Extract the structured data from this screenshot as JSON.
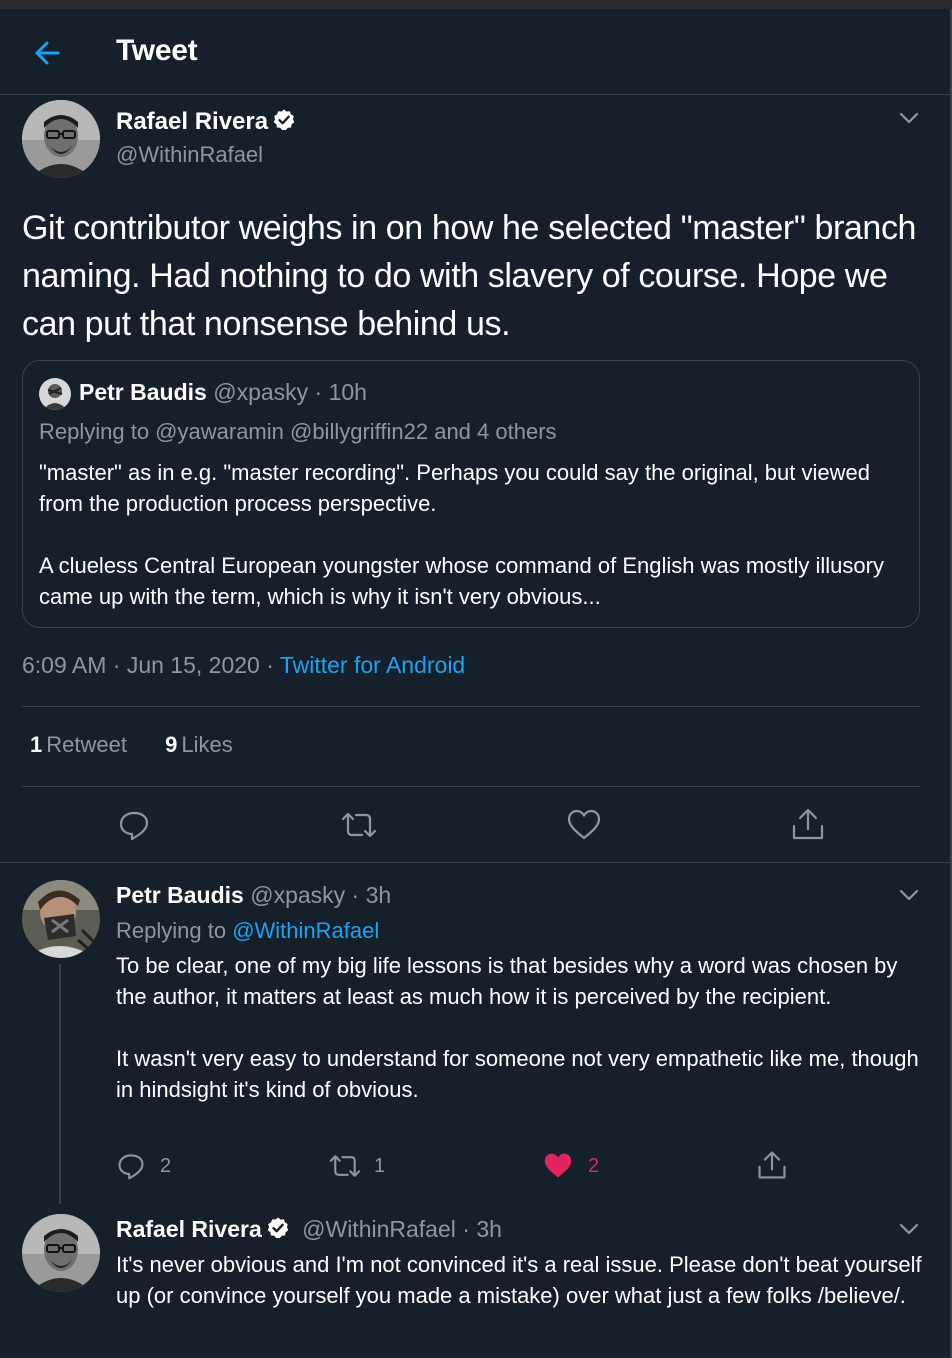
{
  "header": {
    "title": "Tweet"
  },
  "tweet": {
    "author_name": "Rafael Rivera",
    "author_handle": "@WithinRafael",
    "text": "Git contributor weighs in on how he selected \"master\" branch naming. Had nothing to do with slavery of course. Hope we can put that nonsense behind us.",
    "quote": {
      "author_name": "Petr Baudis",
      "author_handle": "@xpasky",
      "time": "· 10h",
      "replying_to": "Replying to @yawaramin @billygriffin22 and 4 others",
      "para1": "\"master\" as in e.g. \"master recording\". Perhaps you could say the original, but viewed from the production process perspective.",
      "para2": "A clueless Central European youngster whose command of English was mostly illusory came up with the term, which is why it isn't very obvious..."
    },
    "timestamp": "6:09 AM · Jun 15, 2020 · ",
    "source": "Twitter for Android",
    "retweets_count": "1",
    "retweets_label": "Retweet",
    "likes_count": "9",
    "likes_label": "Likes"
  },
  "replies": [
    {
      "author_name": "Petr Baudis",
      "author_handle": "@xpasky",
      "time": "· 3h",
      "replying_prefix": "Replying to ",
      "replying_handle": "@WithinRafael",
      "para1": "To be clear, one of my big life lessons is that besides why a word was chosen by the author, it matters at least as much how it is perceived by the recipient.",
      "para2": "It wasn't very easy to understand for someone not very empathetic like me, though in hindsight it's kind of obvious.",
      "reply_count": "2",
      "retweet_count": "1",
      "like_count": "2"
    },
    {
      "author_name": "Rafael Rivera",
      "author_handle": "@WithinRafael",
      "time": "· 3h",
      "para1": "It's never obvious and I'm not convinced it's a real issue. Please don't beat yourself up (or convince yourself you made a mistake) over what just a few folks /believe/."
    }
  ],
  "colors": {
    "background": "#15202b",
    "accent": "#1da1f2",
    "muted": "#8899a6",
    "border": "#38444d",
    "liked": "#e0245e"
  }
}
